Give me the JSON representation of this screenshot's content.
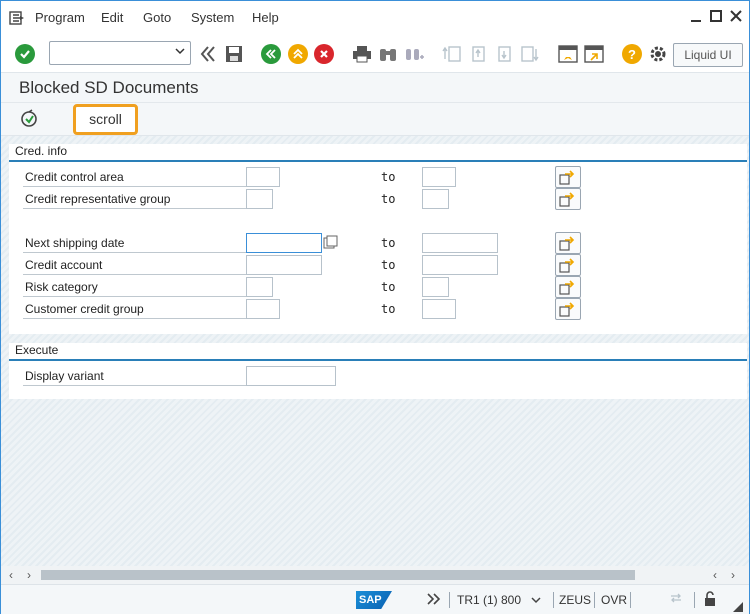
{
  "menu": {
    "items": [
      {
        "label": "Program"
      },
      {
        "label": "Edit"
      },
      {
        "label": "Goto"
      },
      {
        "label": "System"
      },
      {
        "label": "Help"
      }
    ]
  },
  "toolbar": {
    "command_field_value": "",
    "liquid_ui_label": "Liquid UI"
  },
  "page": {
    "title": "Blocked SD Documents"
  },
  "app_toolbar": {
    "scroll_label": "scroll"
  },
  "cred_info": {
    "title": "Cred. info",
    "to_label": "to",
    "rows": [
      {
        "label": "Credit control area",
        "from": "",
        "to": ""
      },
      {
        "label": "Credit representative group",
        "from": "",
        "to": ""
      },
      {
        "label": "Next shipping date",
        "from": "",
        "to": ""
      },
      {
        "label": "Credit account",
        "from": "",
        "to": ""
      },
      {
        "label": "Risk category",
        "from": "",
        "to": ""
      },
      {
        "label": "Customer credit group",
        "from": "",
        "to": ""
      }
    ]
  },
  "execute": {
    "title": "Execute",
    "rows": [
      {
        "label": "Display variant",
        "value": ""
      }
    ]
  },
  "statusbar": {
    "system": "TR1 (1) 800",
    "server": "ZEUS",
    "mode": "OVR",
    "logo": "SAP"
  },
  "colors": {
    "accent": "#2a7fb8",
    "highlight": "#f0a020",
    "enter_green": "#2a9a3c",
    "back_green": "#2a9a3c",
    "exit_yellow": "#f0a800",
    "cancel_red": "#d9262c"
  }
}
